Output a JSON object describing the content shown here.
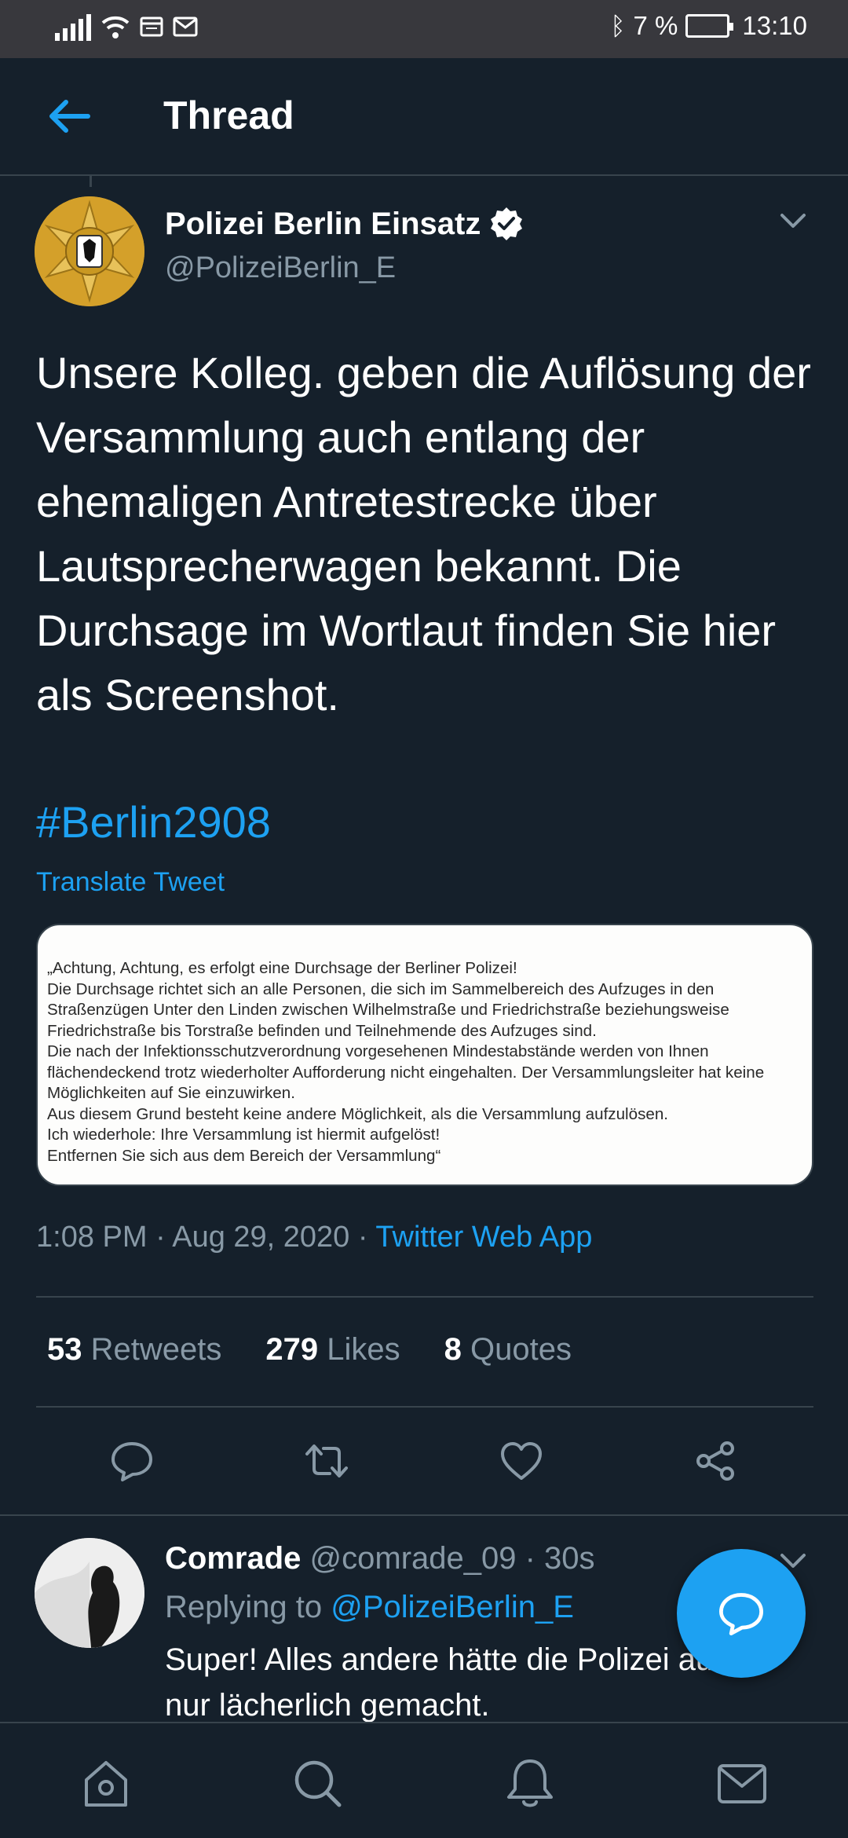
{
  "status_bar": {
    "bluetooth": "✱",
    "battery": "7 %",
    "time": "13:10",
    "icons": [
      "signal-icon",
      "wifi-icon",
      "sim-icon",
      "mail-icon",
      "bluetooth-icon",
      "battery-icon"
    ]
  },
  "header": {
    "title": "Thread",
    "back_icon": "arrow-left-icon"
  },
  "tweet": {
    "author_name": "Polizei Berlin Einsatz",
    "author_handle": "@PolizeiBerlin_E",
    "verified": true,
    "text": "Unsere Kolleg. geben die Auflösung der Versammlung auch entlang der ehemaligen Antretestrecke über Lautsprecherwagen bekannt. Die Durchsage im Wortlaut finden Sie hier als Screenshot.",
    "hashtag": "#Berlin2908",
    "translate_label": "Translate Tweet",
    "media_lines": [
      "„Achtung, Achtung, es erfolgt eine Durchsage der Berliner Polizei!",
      "Die Durchsage richtet sich an alle Personen, die sich im Sammelbereich des Aufzuges in den",
      "Straßenzügen Unter den Linden zwischen Wilhelmstraße und Friedrichstraße beziehungsweise",
      "Friedrichstraße bis Torstraße befinden und Teilnehmende des Aufzuges sind.",
      "Die nach der Infektionsschutzverordnung vorgesehenen Mindestabstände werden von Ihnen",
      "flächendeckend trotz wiederholter Aufforderung nicht eingehalten. Der Versammlungsleiter hat keine",
      "Möglichkeiten auf Sie einzuwirken.",
      "Aus diesem Grund besteht keine andere Möglichkeit, als die Versammlung aufzulösen.",
      "Ich wiederhole: Ihre Versammlung ist hiermit aufgelöst!",
      "Entfernen Sie sich aus dem Bereich der Versammlung“"
    ],
    "time": "1:08 PM",
    "date": "Aug 29, 2020",
    "source": "Twitter Web App",
    "retweets_count": "53",
    "retweets_label": "Retweets",
    "likes_count": "279",
    "likes_label": "Likes",
    "quotes_count": "8",
    "quotes_label": "Quotes"
  },
  "reply": {
    "author_name": "Comrade",
    "author_handle": "@comrade_09",
    "age": "30s",
    "replying_to_label": "Replying to",
    "replying_to_handle": "@PolizeiBerlin_E",
    "text": "Super! Alles andere hätte die Polizei   auch nur lächerlich gemacht."
  },
  "bottom_nav": [
    "home-icon",
    "search-icon",
    "notifications-icon",
    "messages-icon"
  ],
  "colors": {
    "background": "#15202b",
    "accent": "#1da1f2",
    "muted": "#8899a6",
    "divider": "#38444d"
  }
}
